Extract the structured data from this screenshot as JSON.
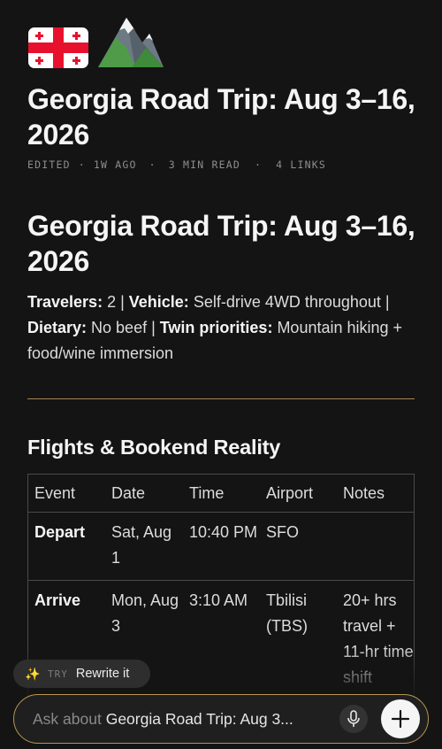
{
  "header": {
    "emojis": [
      {
        "name": "georgia-flag-icon",
        "glyph": "🇬🇪"
      },
      {
        "name": "snow-capped-mountain-icon",
        "glyph": "🏔️"
      }
    ],
    "title": "Georgia Road Trip: Aug 3–16, 2026",
    "meta": {
      "edited": "EDITED",
      "age": "1W AGO",
      "read_time": "3 MIN READ",
      "links": "4 LINKS",
      "separator": "·"
    }
  },
  "content": {
    "heading": "Georgia Road Trip: Aug 3–16, 2026",
    "summary": {
      "travelers_label": "Travelers:",
      "travelers_value": " 2 | ",
      "vehicle_label": "Vehicle:",
      "vehicle_value": " Self-drive 4WD throughout | ",
      "dietary_label": "Dietary:",
      "dietary_value": " No beef | ",
      "priorities_label": "Twin priorities:",
      "priorities_value": " Mountain hiking + food/wine immersion"
    },
    "flights_heading": "Flights & Bookend Reality",
    "table": {
      "headers": [
        "Event",
        "Date",
        "Time",
        "Airport",
        "Notes"
      ],
      "rows": [
        [
          "Depart",
          "Sat, Aug 1",
          "10:40 PM",
          "SFO",
          ""
        ],
        [
          "Arrive",
          "Mon, Aug 3",
          "3:10 AM",
          "Tbilisi (TBS)",
          "20+ hrs travel + 11-hr time shift"
        ]
      ]
    }
  },
  "suggestion": {
    "try_label": "TRY",
    "action_label": "Rewrite it"
  },
  "ask_bar": {
    "placeholder": "Ask about",
    "context": "Georgia Road Trip: Aug 3..."
  },
  "colors": {
    "background": "#141414",
    "accent_gold": "#b8974f",
    "divider": "#a18758"
  }
}
